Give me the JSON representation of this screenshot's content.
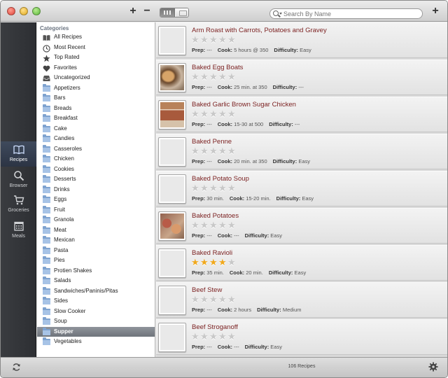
{
  "toolbar": {
    "add_category": "+",
    "remove_category": "−",
    "search_placeholder": "Search By Name",
    "add_recipe": "+"
  },
  "nav": {
    "recipes": "Recipes",
    "browser": "Browser",
    "groceries": "Groceries",
    "meals": "Meals"
  },
  "sidebar": {
    "header": "Categories",
    "special": [
      {
        "label": "All Recipes",
        "icon": "book-icon"
      },
      {
        "label": "Most Recent",
        "icon": "clock-icon"
      },
      {
        "label": "Top Rated",
        "icon": "star-icon"
      },
      {
        "label": "Favorites",
        "icon": "heart-icon"
      },
      {
        "label": "Uncategorized",
        "icon": "tray-icon"
      }
    ],
    "folders": [
      "Appetizers",
      "Bars",
      "Breads",
      "Breakfast",
      "Cake",
      "Candies",
      "Casseroles",
      "Chicken",
      "Cookies",
      "Desserts",
      "Drinks",
      "Eggs",
      "Fruit",
      "Granola",
      "Meat",
      "Mexican",
      "Pasta",
      "Pies",
      "Protien Shakes",
      "Salads",
      "Sandwiches/Paninis/Pitas",
      "Sides",
      "Slow Cooker",
      "Soup",
      "Supper",
      "Vegetables"
    ],
    "selected": "Supper"
  },
  "labels": {
    "prep": "Prep:",
    "cook": "Cook:",
    "difficulty": "Difficulty:"
  },
  "recipes": [
    {
      "title": "Arm Roast with Carrots, Potatoes and Gravey",
      "rating": 0,
      "prep": "---",
      "cook": "5 hours @ 350",
      "difficulty": "Easy",
      "photo": ""
    },
    {
      "title": "Baked Egg Boats",
      "rating": 0,
      "prep": "---",
      "cook": "25 min. at 350",
      "difficulty": "---",
      "photo": "photo1"
    },
    {
      "title": "Baked Garlic Brown Sugar Chicken",
      "rating": 0,
      "prep": "---",
      "cook": "15-30 at 500",
      "difficulty": "---",
      "photo": "photo2"
    },
    {
      "title": "Baked Penne",
      "rating": 0,
      "prep": "---",
      "cook": "20 min. at 350",
      "difficulty": "Easy",
      "photo": ""
    },
    {
      "title": "Baked Potato Soup",
      "rating": 0,
      "prep": "30 min.",
      "cook": "15-20 min.",
      "difficulty": "Easy",
      "photo": ""
    },
    {
      "title": "Baked Potatoes",
      "rating": 0,
      "prep": "---",
      "cook": "---",
      "difficulty": "Easy",
      "photo": "photo3"
    },
    {
      "title": "Baked Ravioli",
      "rating": 4,
      "prep": "35 min.",
      "cook": "20 min.",
      "difficulty": "Easy",
      "photo": ""
    },
    {
      "title": "Beef Stew",
      "rating": 0,
      "prep": "---",
      "cook": "2 hours",
      "difficulty": "Medium",
      "photo": ""
    },
    {
      "title": "Beef Stroganoff",
      "rating": 0,
      "prep": "---",
      "cook": "---",
      "difficulty": "Easy",
      "photo": ""
    }
  ],
  "footer": {
    "count": "106 Recipes"
  },
  "colors": {
    "title_text": "#7a1f1f",
    "star_on": "#f0a81c",
    "star_off": "#c8c8c8",
    "selection": "#7f848b"
  }
}
